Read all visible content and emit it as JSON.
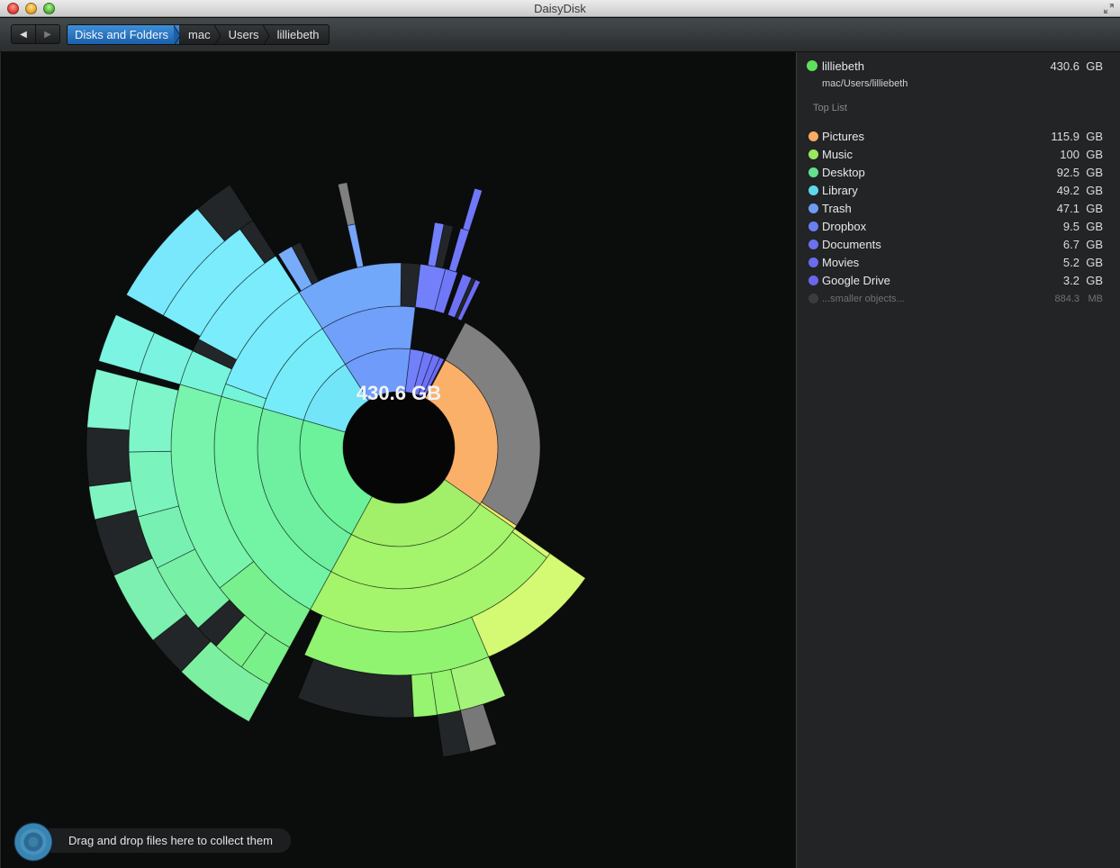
{
  "window": {
    "title": "DaisyDisk"
  },
  "toolbar": {
    "back_label": "◀",
    "forward_label": "▶",
    "breadcrumbs": [
      {
        "label": "Disks and Folders",
        "active": true
      },
      {
        "label": "mac",
        "active": false
      },
      {
        "label": "Users",
        "active": false
      },
      {
        "label": "lilliebeth",
        "active": false
      }
    ]
  },
  "sidebar": {
    "current": {
      "name": "lilliebeth",
      "size": "430.6",
      "unit": "GB",
      "path": "mac/Users/lilliebeth",
      "color": "#5fe05a"
    },
    "top_list_label": "Top List",
    "items": [
      {
        "name": "Pictures",
        "size": "115.9",
        "unit": "GB",
        "color": "#fbab62"
      },
      {
        "name": "Music",
        "size": "100",
        "unit": "GB",
        "color": "#9ae85e"
      },
      {
        "name": "Desktop",
        "size": "92.5",
        "unit": "GB",
        "color": "#64e08e"
      },
      {
        "name": "Library",
        "size": "49.2",
        "unit": "GB",
        "color": "#5fd8ec"
      },
      {
        "name": "Trash",
        "size": "47.1",
        "unit": "GB",
        "color": "#6d9cf2"
      },
      {
        "name": "Dropbox",
        "size": "9.5",
        "unit": "GB",
        "color": "#6b7ef0"
      },
      {
        "name": "Documents",
        "size": "6.7",
        "unit": "GB",
        "color": "#6a72ee"
      },
      {
        "name": "Movies",
        "size": "5.2",
        "unit": "GB",
        "color": "#6a6cee"
      },
      {
        "name": "Google Drive",
        "size": "3.2",
        "unit": "GB",
        "color": "#6a66ec"
      },
      {
        "name": "...smaller objects...",
        "size": "884.3",
        "unit": "MB",
        "color": "#3a3c3e",
        "muted": true
      }
    ]
  },
  "chart": {
    "center_label": "430.6 GB"
  },
  "collector": {
    "hint": "Drag and drop files here to collect them"
  },
  "chart_data": {
    "type": "sunburst",
    "title": "lilliebeth",
    "total": "430.6 GB",
    "series": [
      {
        "name": "Pictures",
        "value_gb": 115.9,
        "color": "#fbb06a"
      },
      {
        "name": "Music",
        "value_gb": 100,
        "color": "#a2f06a"
      },
      {
        "name": "Desktop",
        "value_gb": 92.5,
        "color": "#6cf29a"
      },
      {
        "name": "Library",
        "value_gb": 49.2,
        "color": "#72e6f8"
      },
      {
        "name": "Trash",
        "value_gb": 47.1,
        "color": "#6f9cfa"
      },
      {
        "name": "Dropbox",
        "value_gb": 9.5,
        "color": "#7280fa"
      },
      {
        "name": "Documents",
        "value_gb": 6.7,
        "color": "#7078f8"
      },
      {
        "name": "Movies",
        "value_gb": 5.2,
        "color": "#6e72f6"
      },
      {
        "name": "Google Drive",
        "value_gb": 3.2,
        "color": "#6c6cf4"
      },
      {
        "name": "smaller objects",
        "value_gb": 0.8843,
        "color": "#26282a"
      }
    ]
  }
}
